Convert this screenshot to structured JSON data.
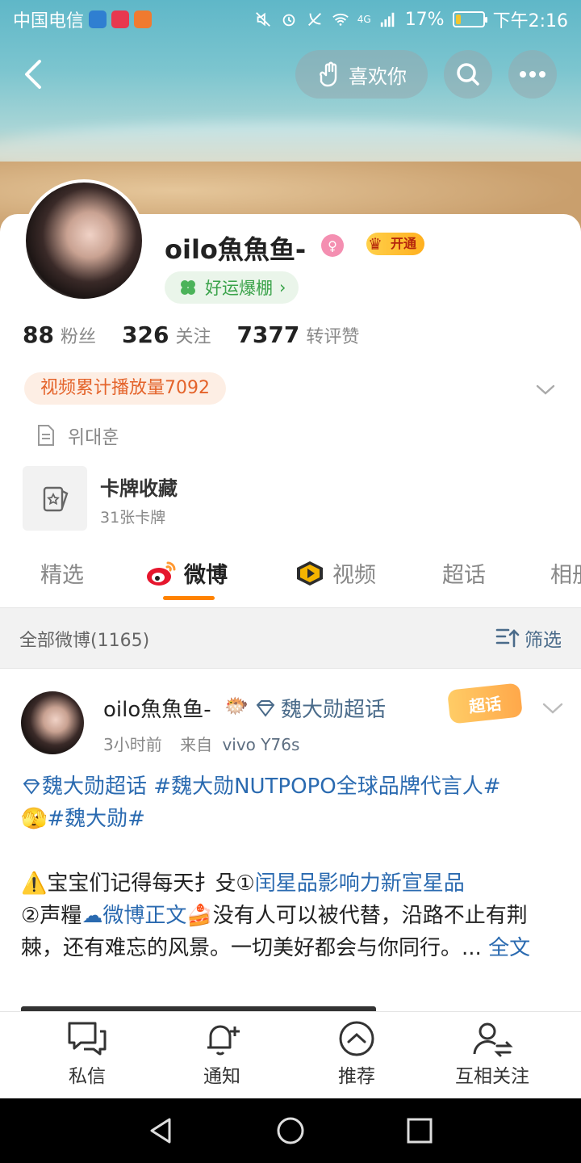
{
  "status_bar": {
    "carrier": "中国电信",
    "network": "4G",
    "battery": "17%",
    "time": "下午2:16",
    "battery_level": 0.17
  },
  "top_nav": {
    "like_label": "喜欢你"
  },
  "profile": {
    "name": "oilo魚魚鱼-",
    "vip_label": "开通",
    "luck_label": "好运爆棚",
    "stats": [
      {
        "num": "88",
        "label": "粉丝"
      },
      {
        "num": "326",
        "label": "关注"
      },
      {
        "num": "7377",
        "label": "转评赞"
      }
    ],
    "play_tag": "视频累计播放量7092",
    "bio": "위대훈",
    "cards_title": "卡牌收藏",
    "cards_sub": "31张卡牌"
  },
  "tabs": [
    {
      "label": "精选"
    },
    {
      "label": "微博"
    },
    {
      "label": "视频"
    },
    {
      "label": "超话"
    },
    {
      "label": "相册"
    }
  ],
  "filter_bar": {
    "count": "全部微博(1165)",
    "filter_label": "筛选"
  },
  "post": {
    "name": "oilo魚魚鱼-",
    "topic": "魏大勋超话",
    "badge": "超话",
    "time": "3小时前",
    "source_prefix": "来自",
    "device": "vivo Y76s",
    "line1_tag1": "魏大勋超话",
    "line1_tag2": "#魏大勋NUTPOPO全球品牌代言人#",
    "line2_tag": "#魏大勋#",
    "para_a1": "宝宝们记得每天扌殳①",
    "para_a_link": "闰星品影响力新宣星品",
    "para_b1": "②声糧",
    "para_b_link": "微博正文",
    "para_b2": "没有人可以被代替，沿路不止有荆棘，还有难忘的风景。一切美好都会与你同行。...",
    "full_text": "全文"
  },
  "action_bar": {
    "items": [
      {
        "label": "私信"
      },
      {
        "label": "通知"
      },
      {
        "label": "推荐"
      },
      {
        "label": "互相关注"
      }
    ]
  },
  "colors": {
    "accent_orange": "#ff8200",
    "link_blue": "#4a6b8a",
    "luck_green": "#3aa34a"
  }
}
